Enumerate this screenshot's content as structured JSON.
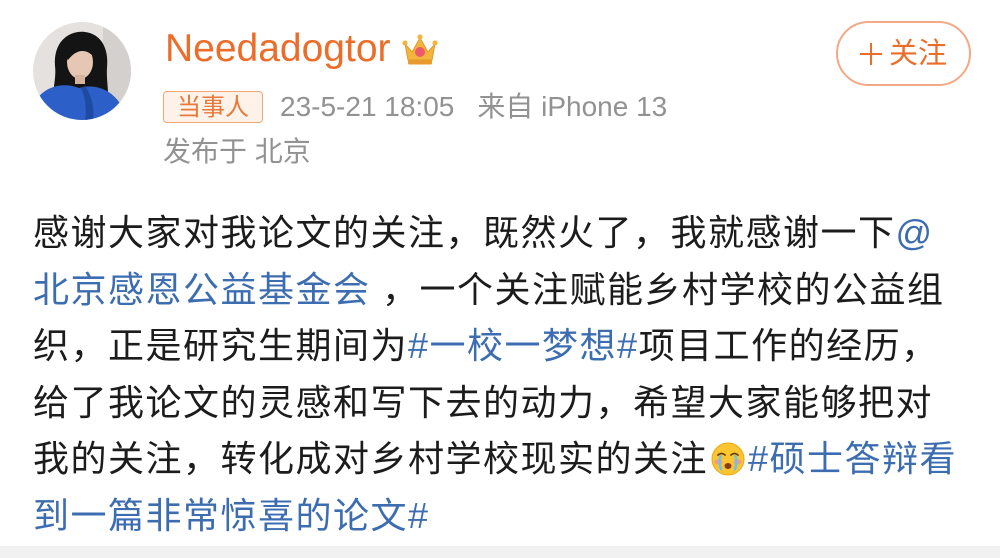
{
  "colors": {
    "accent": "#ec6d2a",
    "follow_border": "#f3a985",
    "badge_text": "#e9793b",
    "badge_bg": "#fff2e9",
    "badge_border": "#f4a675",
    "meta": "#929292",
    "text": "#1c1c1c",
    "link": "#3d6db1",
    "divider": "#f1f1f1"
  },
  "icons": {
    "vip_badge": "vip-crown-icon",
    "follow": "plus-icon",
    "emoji": "crying-face-emoji-icon"
  },
  "user": {
    "name": "Needadogtor"
  },
  "follow_button": {
    "label": "关注"
  },
  "meta": {
    "badge": "当事人",
    "timestamp": "23-5-21 18:05",
    "source": "来自 iPhone 13",
    "location": "发布于 北京"
  },
  "post": {
    "lines": [
      [
        "感谢大家对我论文的关注，既然火了，我就感谢一下",
        "@"
      ],
      [
        "北京感恩公益基金会",
        " ，一个关注赋能乡村学校的公益组"
      ],
      [
        "织，正是研究生期间为",
        "#一校一梦想#",
        "项目工作的经历，"
      ],
      [
        "给了我论文的灵感和写下去的动力，希望大家能够把对"
      ],
      [
        "我的关注，转化成对乡村学校现实的关注",
        "#硕士答辩看"
      ],
      [
        "到一篇非常惊喜的论文#"
      ]
    ]
  }
}
